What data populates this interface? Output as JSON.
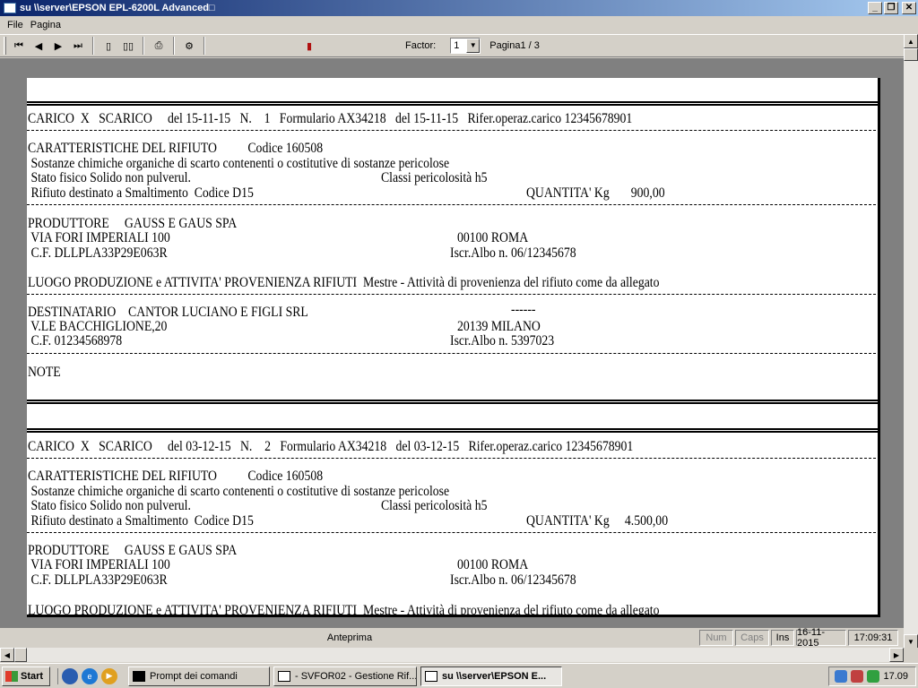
{
  "window": {
    "title": "su \\\\server\\EPSON EPL-6200L Advanced□",
    "minimize": "_",
    "restore": "❐",
    "close": "✕"
  },
  "menu": {
    "items": [
      "File",
      "Pagina"
    ]
  },
  "toolbar": {
    "first_icon": "⏮",
    "prev_icon": "◀",
    "next_icon": "▶",
    "last_icon": "⏭",
    "single_page_icon": "▯",
    "two_pages_icon": "▯▯",
    "print_icon": "⎙",
    "setup_icon": "⚙",
    "exit_icon": "▮",
    "factor_label": "Factor:",
    "factor_value": "1",
    "page_label": "Pagina1 / 3"
  },
  "report": {
    "records": [
      {
        "header": "CARICO  X   SCARICO     del 15-11-15   N.    1   Formulario AX34218   del 15-11-15   Rifer.operaz.carico 12345678901",
        "caratt": "CARATTERISTICHE DEL RIFIUTO          Codice 160508",
        "sostanze": " Sostanze chimiche organiche di scarto contenenti o costitutive di sostanze pericolose",
        "stato": " Stato fisico Solido non pulverul.",
        "classi": "Classi pericolosità h5",
        "rifiuto": " Rifiuto destinato a Smaltimento  Codice D15",
        "quantita": "QUANTITA' Kg       900,00",
        "produttore": "PRODUTTORE     GAUSS E GAUS SPA",
        "prod_via": " VIA FORI IMPERIALI 100",
        "prod_cap": "00100 ROMA",
        "prod_cf": " C.F. DLLPLA33P29E063R",
        "prod_albo": "Iscr.Albo n. 06/12345678",
        "luogo": "LUOGO PRODUZIONE e ATTIVITA' PROVENIENZA RIFIUTI  Mestre - Attività di provenienza del rifiuto come da allegato",
        "destinatario": "DESTINATARIO    CANTOR LUCIANO E FIGLI SRL",
        "dest_dash": "------",
        "dest_via": " V.LE BACCHIGLIONE,20",
        "dest_cap": "20139 MILANO",
        "dest_cf": " C.F. 01234568978",
        "dest_albo": "Iscr.Albo n. 5397023",
        "note": "NOTE"
      },
      {
        "header": "CARICO  X   SCARICO     del 03-12-15   N.    2   Formulario AX34218   del 03-12-15   Rifer.operaz.carico 12345678901",
        "caratt": "CARATTERISTICHE DEL RIFIUTO          Codice 160508",
        "sostanze": " Sostanze chimiche organiche di scarto contenenti o costitutive di sostanze pericolose",
        "stato": " Stato fisico Solido non pulverul.",
        "classi": "Classi pericolosità h5",
        "rifiuto": " Rifiuto destinato a Smaltimento  Codice D15",
        "quantita": "QUANTITA' Kg     4.500,00",
        "produttore": "PRODUTTORE     GAUSS E GAUS SPA",
        "prod_via": " VIA FORI IMPERIALI 100",
        "prod_cap": "00100 ROMA",
        "prod_cf": " C.F. DLLPLA33P29E063R",
        "prod_albo": "Iscr.Albo n. 06/12345678",
        "luogo": "LUOGO PRODUZIONE e ATTIVITA' PROVENIENZA RIFIUTI  Mestre - Attività di provenienza del rifiuto come da allegato"
      }
    ]
  },
  "status": {
    "main": "Anteprima",
    "num": "Num",
    "caps": "Caps",
    "ins": "Ins",
    "date": "16-11-2015",
    "time": "17:09:31"
  },
  "taskbar": {
    "start": "Start",
    "tasks": [
      "Prompt dei comandi",
      "- SVFOR02 - Gestione Rif...",
      "su \\\\server\\EPSON E..."
    ],
    "clock": "17.09"
  }
}
